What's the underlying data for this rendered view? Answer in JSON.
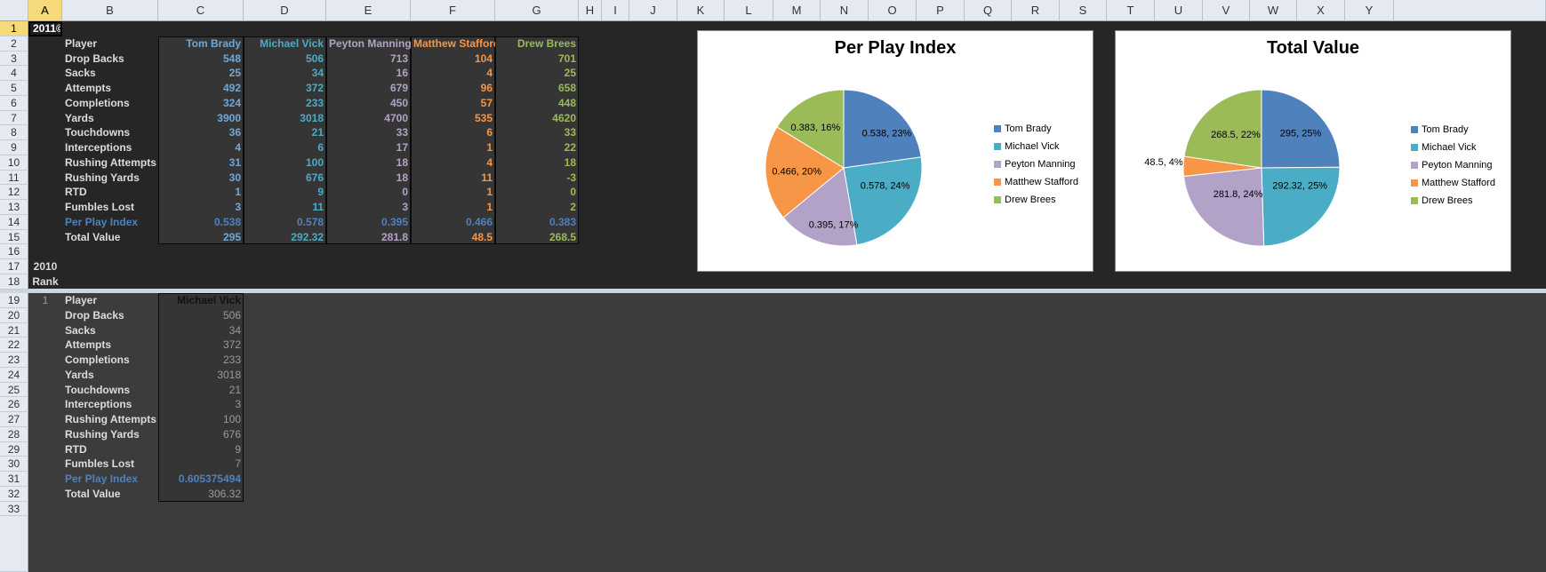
{
  "columns": [
    "A",
    "B",
    "C",
    "D",
    "E",
    "F",
    "G",
    "H",
    "I",
    "J",
    "K",
    "L",
    "M",
    "N",
    "O",
    "P",
    "Q",
    "R",
    "S",
    "T",
    "U",
    "V",
    "W",
    "X",
    "Y"
  ],
  "selected_cell": {
    "value": "2011©"
  },
  "colors": {
    "tom_brady": "#4f81bd",
    "michael_vick": "#4bacc6",
    "peyton_manning": "#b3a2c7",
    "matthew_stafford": "#f79646",
    "drew_brees": "#9bbb59"
  },
  "table2011": {
    "header": [
      "Player",
      "Tom Brady",
      "Michael Vick",
      "Peyton Manning",
      "Matthew Stafford",
      "Drew Brees"
    ],
    "rows": [
      [
        "Drop Backs",
        "548",
        "506",
        "713",
        "104",
        "701"
      ],
      [
        "Sacks",
        "25",
        "34",
        "16",
        "4",
        "25"
      ],
      [
        "Attempts",
        "492",
        "372",
        "679",
        "96",
        "658"
      ],
      [
        "Completions",
        "324",
        "233",
        "450",
        "57",
        "448"
      ],
      [
        "Yards",
        "3900",
        "3018",
        "4700",
        "535",
        "4620"
      ],
      [
        "Touchdowns",
        "36",
        "21",
        "33",
        "6",
        "33"
      ],
      [
        "Interceptions",
        "4",
        "6",
        "17",
        "1",
        "22"
      ],
      [
        "Rushing Attempts",
        "31",
        "100",
        "18",
        "4",
        "18"
      ],
      [
        "Rushing Yards",
        "30",
        "676",
        "18",
        "11",
        "-3"
      ],
      [
        "RTD",
        "1",
        "9",
        "0",
        "1",
        "0"
      ],
      [
        "Fumbles Lost",
        "3",
        "11",
        "3",
        "1",
        "2"
      ],
      [
        "Per Play Index",
        "0.538",
        "0.578",
        "0.395",
        "0.466",
        "0.383"
      ],
      [
        "Total Value",
        "295",
        "292.32",
        "281.8",
        "48.5",
        "268.5"
      ]
    ]
  },
  "section2010": {
    "year": "2010",
    "rank_label": "Rank",
    "rank": "1"
  },
  "table2010": {
    "header": [
      "Player",
      "Michael Vick"
    ],
    "rows": [
      [
        "Drop Backs",
        "506"
      ],
      [
        "Sacks",
        "34"
      ],
      [
        "Attempts",
        "372"
      ],
      [
        "Completions",
        "233"
      ],
      [
        "Yards",
        "3018"
      ],
      [
        "Touchdowns",
        "21"
      ],
      [
        "Interceptions",
        "3"
      ],
      [
        "Rushing Attempts",
        "100"
      ],
      [
        "Rushing Yards",
        "676"
      ],
      [
        "RTD",
        "9"
      ],
      [
        "Fumbles Lost",
        "7"
      ],
      [
        "Per Play Index",
        "0.605375494"
      ],
      [
        "Total Value",
        "306.32"
      ]
    ]
  },
  "chart_data": [
    {
      "type": "pie",
      "title": "Per Play Index",
      "categories": [
        "Tom Brady",
        "Michael Vick",
        "Peyton Manning",
        "Matthew Stafford",
        "Drew Brees"
      ],
      "values": [
        0.538,
        0.578,
        0.395,
        0.466,
        0.383
      ],
      "data_labels": [
        "0.538, 23%",
        "0.578, 24%",
        "0.395, 17%",
        "0.466, 20%",
        "0.383, 16%"
      ],
      "legend": "right"
    },
    {
      "type": "pie",
      "title": "Total Value",
      "categories": [
        "Tom Brady",
        "Michael Vick",
        "Peyton Manning",
        "Matthew Stafford",
        "Drew Brees"
      ],
      "values": [
        295,
        292.32,
        281.8,
        48.5,
        268.5
      ],
      "data_labels": [
        "295, 25%",
        "292.32, 25%",
        "281.8, 24%",
        "48.5, 4%",
        "268.5, 22%"
      ],
      "legend": "right"
    }
  ]
}
